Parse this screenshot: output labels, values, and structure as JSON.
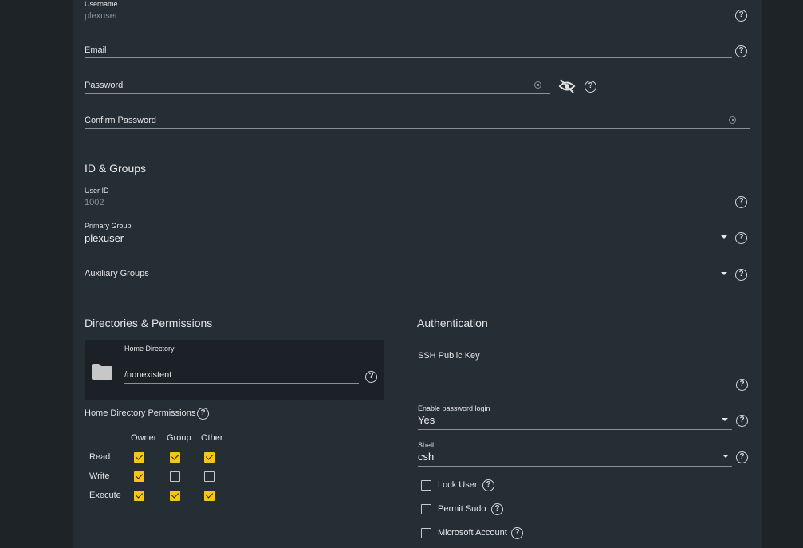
{
  "account": {
    "username": {
      "label": "Username",
      "value": "plexuser"
    },
    "email": {
      "label": "Email",
      "value": ""
    },
    "password": {
      "label": "Password",
      "value": ""
    },
    "confirm_password": {
      "label": "Confirm Password",
      "value": ""
    }
  },
  "id_groups": {
    "title": "ID & Groups",
    "user_id": {
      "label": "User ID",
      "value": "1002"
    },
    "primary_group": {
      "label": "Primary Group",
      "value": "plexuser"
    },
    "auxiliary_groups": {
      "label": "Auxiliary Groups",
      "value": ""
    }
  },
  "directories": {
    "title": "Directories & Permissions",
    "home_directory": {
      "label": "Home Directory",
      "value": "/nonexistent"
    },
    "permissions_label": "Home Directory Permissions",
    "columns": [
      "Owner",
      "Group",
      "Other"
    ],
    "rows": [
      {
        "label": "Read",
        "values": [
          true,
          true,
          true
        ]
      },
      {
        "label": "Write",
        "values": [
          true,
          false,
          false
        ]
      },
      {
        "label": "Execute",
        "values": [
          true,
          true,
          true
        ]
      }
    ]
  },
  "authentication": {
    "title": "Authentication",
    "ssh_key": {
      "label": "SSH Public Key",
      "value": ""
    },
    "password_login": {
      "label": "Enable password login",
      "value": "Yes"
    },
    "shell": {
      "label": "Shell",
      "value": "csh"
    },
    "checkboxes": [
      {
        "label": "Lock User",
        "checked": false
      },
      {
        "label": "Permit Sudo",
        "checked": false
      },
      {
        "label": "Microsoft Account",
        "checked": false
      }
    ]
  },
  "icons": {
    "help": "?",
    "folder": "folder-icon",
    "eye_off": "eye-off-icon",
    "key": "key-icon"
  },
  "colors": {
    "accent": "#f5c518",
    "panel": "#252d35",
    "background": "#1e2328"
  }
}
